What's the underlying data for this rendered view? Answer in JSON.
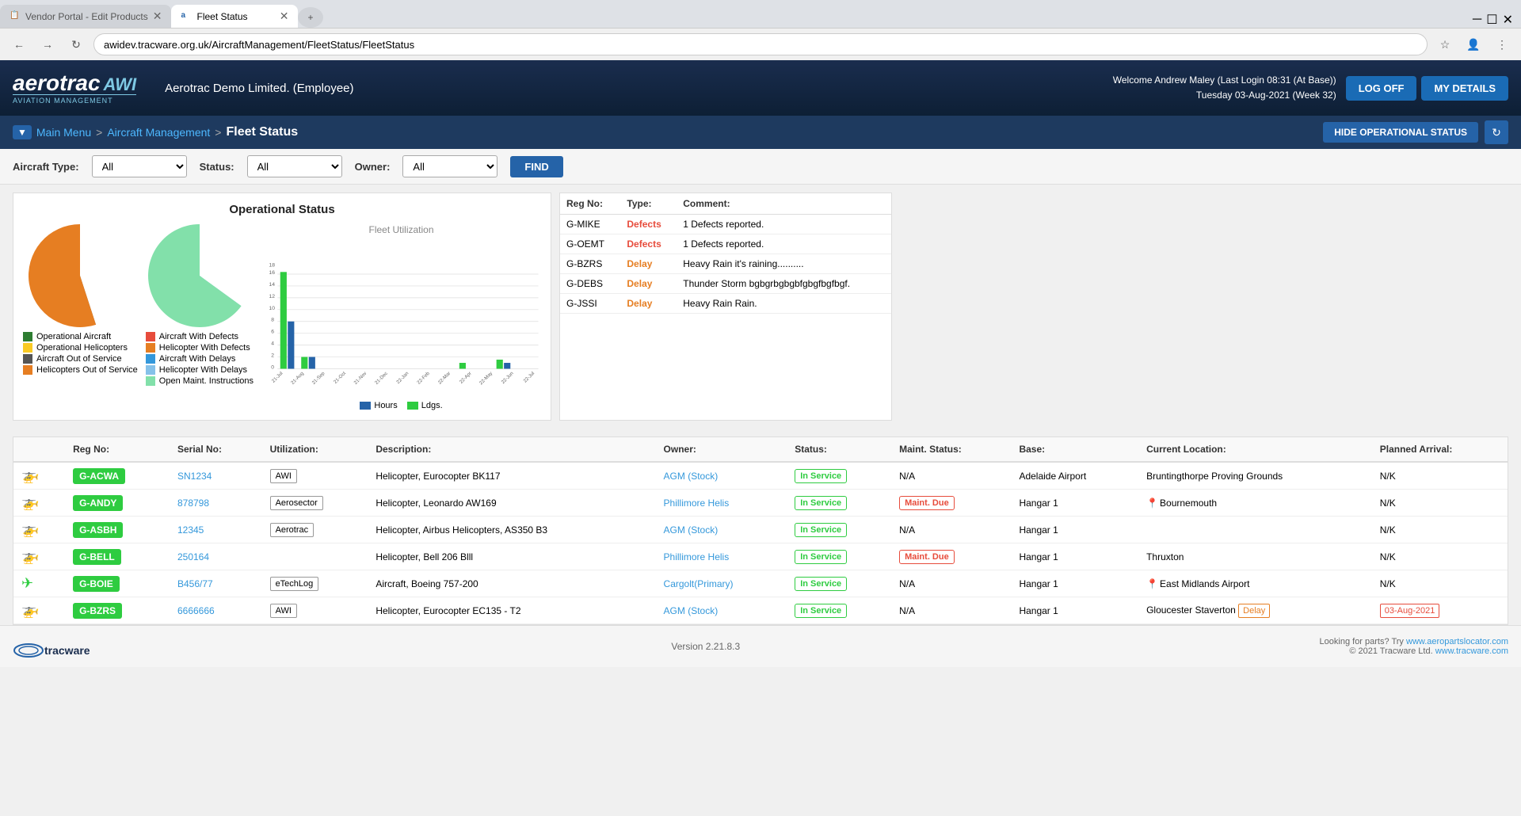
{
  "browser": {
    "tabs": [
      {
        "label": "Vendor Portal - Edit Products",
        "active": false,
        "favicon": "📋"
      },
      {
        "label": "Fleet Status",
        "active": true,
        "favicon": "a"
      }
    ],
    "address": "awidev.tracware.org.uk/AircraftManagement/FleetStatus/FleetStatus"
  },
  "header": {
    "company": "Aerotrac Demo Limited. (Employee)",
    "welcome": "Welcome Andrew Maley (Last Login 08:31 (At Base))",
    "date": "Tuesday 03-Aug-2021 (Week 32)",
    "logoff_label": "LOG OFF",
    "mydetails_label": "MY DETAILS"
  },
  "breadcrumb": {
    "main_menu": "Main Menu",
    "aircraft_management": "Aircraft Management",
    "current": "Fleet Status",
    "hide_status_label": "HIDE OPERATIONAL STATUS"
  },
  "filters": {
    "aircraft_type_label": "Aircraft Type:",
    "aircraft_type_value": "All",
    "status_label": "Status:",
    "status_value": "All",
    "owner_label": "Owner:",
    "owner_value": "All",
    "find_label": "FIND"
  },
  "operational_status": {
    "title": "Operational Status",
    "pie1_legend": [
      {
        "color": "#2e7d32",
        "label": "Operational Aircraft"
      },
      {
        "color": "#f9ca24",
        "label": "Operational Helicopters"
      },
      {
        "color": "#555",
        "label": "Aircraft Out of Service"
      },
      {
        "color": "#e67e22",
        "label": "Helicopters Out of Service"
      }
    ],
    "pie2_legend": [
      {
        "color": "#e74c3c",
        "label": "Aircraft With Defects"
      },
      {
        "color": "#e67e22",
        "label": "Helicopter With Defects"
      },
      {
        "color": "#3498db",
        "label": "Aircraft With Delays"
      },
      {
        "color": "#85c1e9",
        "label": "Helicopter With Delays"
      },
      {
        "color": "#82e0aa",
        "label": "Open Maint. Instructions"
      }
    ],
    "fleet_utilization_title": "Fleet Utilization",
    "chart_y_labels": [
      0,
      2,
      4,
      6,
      8,
      10,
      12,
      14,
      16,
      18
    ],
    "chart_x_labels": [
      "21-Jul",
      "21-Aug",
      "21-Sep",
      "21-Oct",
      "21-Nov",
      "21-Dec",
      "22-Jan",
      "22-Feb",
      "22-Mar",
      "22-Apr",
      "22-May",
      "22-Jun",
      "22-Jul"
    ],
    "bar_legend": [
      {
        "color": "#2563a8",
        "label": "Hours"
      },
      {
        "color": "#2ecc40",
        "label": "Ldgs."
      }
    ]
  },
  "status_alerts": {
    "columns": [
      "Reg No:",
      "Type:",
      "Comment:"
    ],
    "rows": [
      {
        "reg": "G-MIKE",
        "type": "Defects",
        "type_class": "defects",
        "comment": "1 Defects reported."
      },
      {
        "reg": "G-OEMT",
        "type": "Defects",
        "type_class": "defects",
        "comment": "1 Defects reported."
      },
      {
        "reg": "G-BZRS",
        "type": "Delay",
        "type_class": "delay",
        "comment": "Heavy Rain it's raining.........."
      },
      {
        "reg": "G-DEBS",
        "type": "Delay",
        "type_class": "delay",
        "comment": "Thunder Storm bgbgrbgbgbfgbgfbgfbgf."
      },
      {
        "reg": "G-JSSI",
        "type": "Delay",
        "type_class": "delay",
        "comment": "Heavy Rain Rain."
      }
    ]
  },
  "aircraft_table": {
    "columns": [
      "Reg No:",
      "Serial No:",
      "Utilization:",
      "Description:",
      "Owner:",
      "Status:",
      "Maint. Status:",
      "Base:",
      "Current Location:",
      "Planned Arrival:"
    ],
    "rows": [
      {
        "icon": "heli",
        "reg": "G-ACWA",
        "serial": "SN1234",
        "utilization": "AWI",
        "description": "Helicopter, Eurocopter BK117",
        "owner": "AGM (Stock)",
        "status": "In Service",
        "maint_status": "N/A",
        "base": "Adelaide Airport",
        "location": "Bruntingthorpe Proving Grounds",
        "location_pin": false,
        "planned_arrival": "N/K",
        "delay": "",
        "arrival_date": ""
      },
      {
        "icon": "heli",
        "reg": "G-ANDY",
        "serial": "878798",
        "utilization": "Aerosector",
        "description": "Helicopter, Leonardo AW169",
        "owner": "Phillimore Helis",
        "status": "In Service",
        "maint_status": "Maint. Due",
        "base": "Hangar 1",
        "location": "Bournemouth",
        "location_pin": true,
        "planned_arrival": "N/K",
        "delay": "",
        "arrival_date": ""
      },
      {
        "icon": "heli",
        "reg": "G-ASBH",
        "serial": "12345",
        "utilization": "Aerotrac",
        "description": "Helicopter, Airbus Helicopters, AS350 B3",
        "owner": "AGM (Stock)",
        "status": "In Service",
        "maint_status": "N/A",
        "base": "Hangar 1",
        "location": "",
        "location_pin": false,
        "planned_arrival": "N/K",
        "delay": "",
        "arrival_date": ""
      },
      {
        "icon": "heli",
        "reg": "G-BELL",
        "serial": "250164",
        "utilization": "",
        "description": "Helicopter, Bell 206 Blll",
        "owner": "Phillimore Helis",
        "status": "In Service",
        "maint_status": "Maint. Due",
        "base": "Hangar 1",
        "location": "Thruxton",
        "location_pin": false,
        "planned_arrival": "N/K",
        "delay": "",
        "arrival_date": ""
      },
      {
        "icon": "plane",
        "reg": "G-BOIE",
        "serial": "B456/77",
        "utilization": "eTechLog",
        "description": "Aircraft, Boeing 757-200",
        "owner": "Cargolt(Primary)",
        "status": "In Service",
        "maint_status": "N/A",
        "base": "Hangar 1",
        "location": "East Midlands Airport",
        "location_pin": true,
        "planned_arrival": "N/K",
        "delay": "",
        "arrival_date": ""
      },
      {
        "icon": "heli",
        "reg": "G-BZRS",
        "serial": "6666666",
        "utilization": "AWI",
        "description": "Helicopter, Eurocopter EC135 - T2",
        "owner": "AGM (Stock)",
        "status": "In Service",
        "maint_status": "N/A",
        "base": "Hangar 1",
        "location": "Gloucester Staverton",
        "location_pin": false,
        "planned_arrival": "03-Aug-2021",
        "delay": "Delay",
        "arrival_date": "03-Aug-2021"
      }
    ]
  },
  "footer": {
    "version": "Version 2.21.8.3",
    "parts_text": "Looking for parts? Try ",
    "parts_link": "www.aeropartslocator.com",
    "copyright": "© 2021 Tracware Ltd. ",
    "tracware_link": "www.tracware.com"
  }
}
